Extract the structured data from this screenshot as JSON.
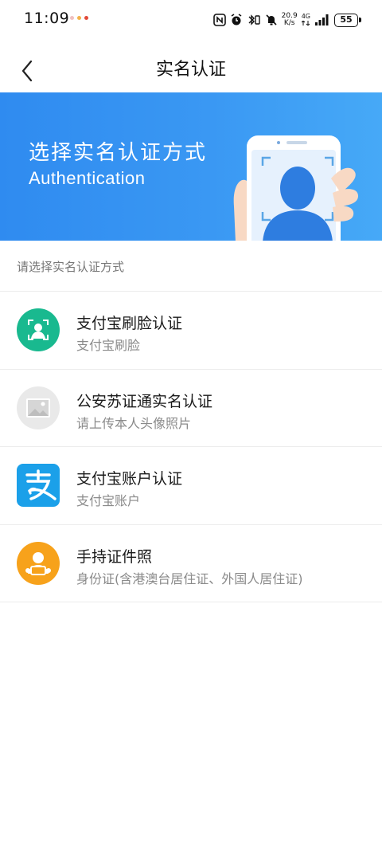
{
  "status_bar": {
    "time": "11:09",
    "net_speed_value": "20.9",
    "net_speed_unit": "K/s",
    "network_type": "4G",
    "battery": "55"
  },
  "nav": {
    "title": "实名认证"
  },
  "banner": {
    "title": "选择实名认证方式",
    "subtitle": "Authentication"
  },
  "section_label": "请选择实名认证方式",
  "methods": [
    {
      "title": "支付宝刷脸认证",
      "desc": "支付宝刷脸",
      "icon": "face-scan-icon",
      "color": "#19b98f"
    },
    {
      "title": "公安苏证通实名认证",
      "desc": "请上传本人头像照片",
      "icon": "image-placeholder-icon",
      "color": "#e9e9e9"
    },
    {
      "title": "支付宝账户认证",
      "desc": "支付宝账户",
      "icon": "alipay-icon",
      "color": "#1ba0e9"
    },
    {
      "title": "手持证件照",
      "desc": "身份证(含港澳台居住证、外国人居住证)",
      "icon": "hand-held-id-icon",
      "color": "#f7a21b"
    }
  ],
  "colors": {
    "banner_start": "#2f8bf0",
    "banner_end": "#46a9f7",
    "divider": "#ececec"
  }
}
